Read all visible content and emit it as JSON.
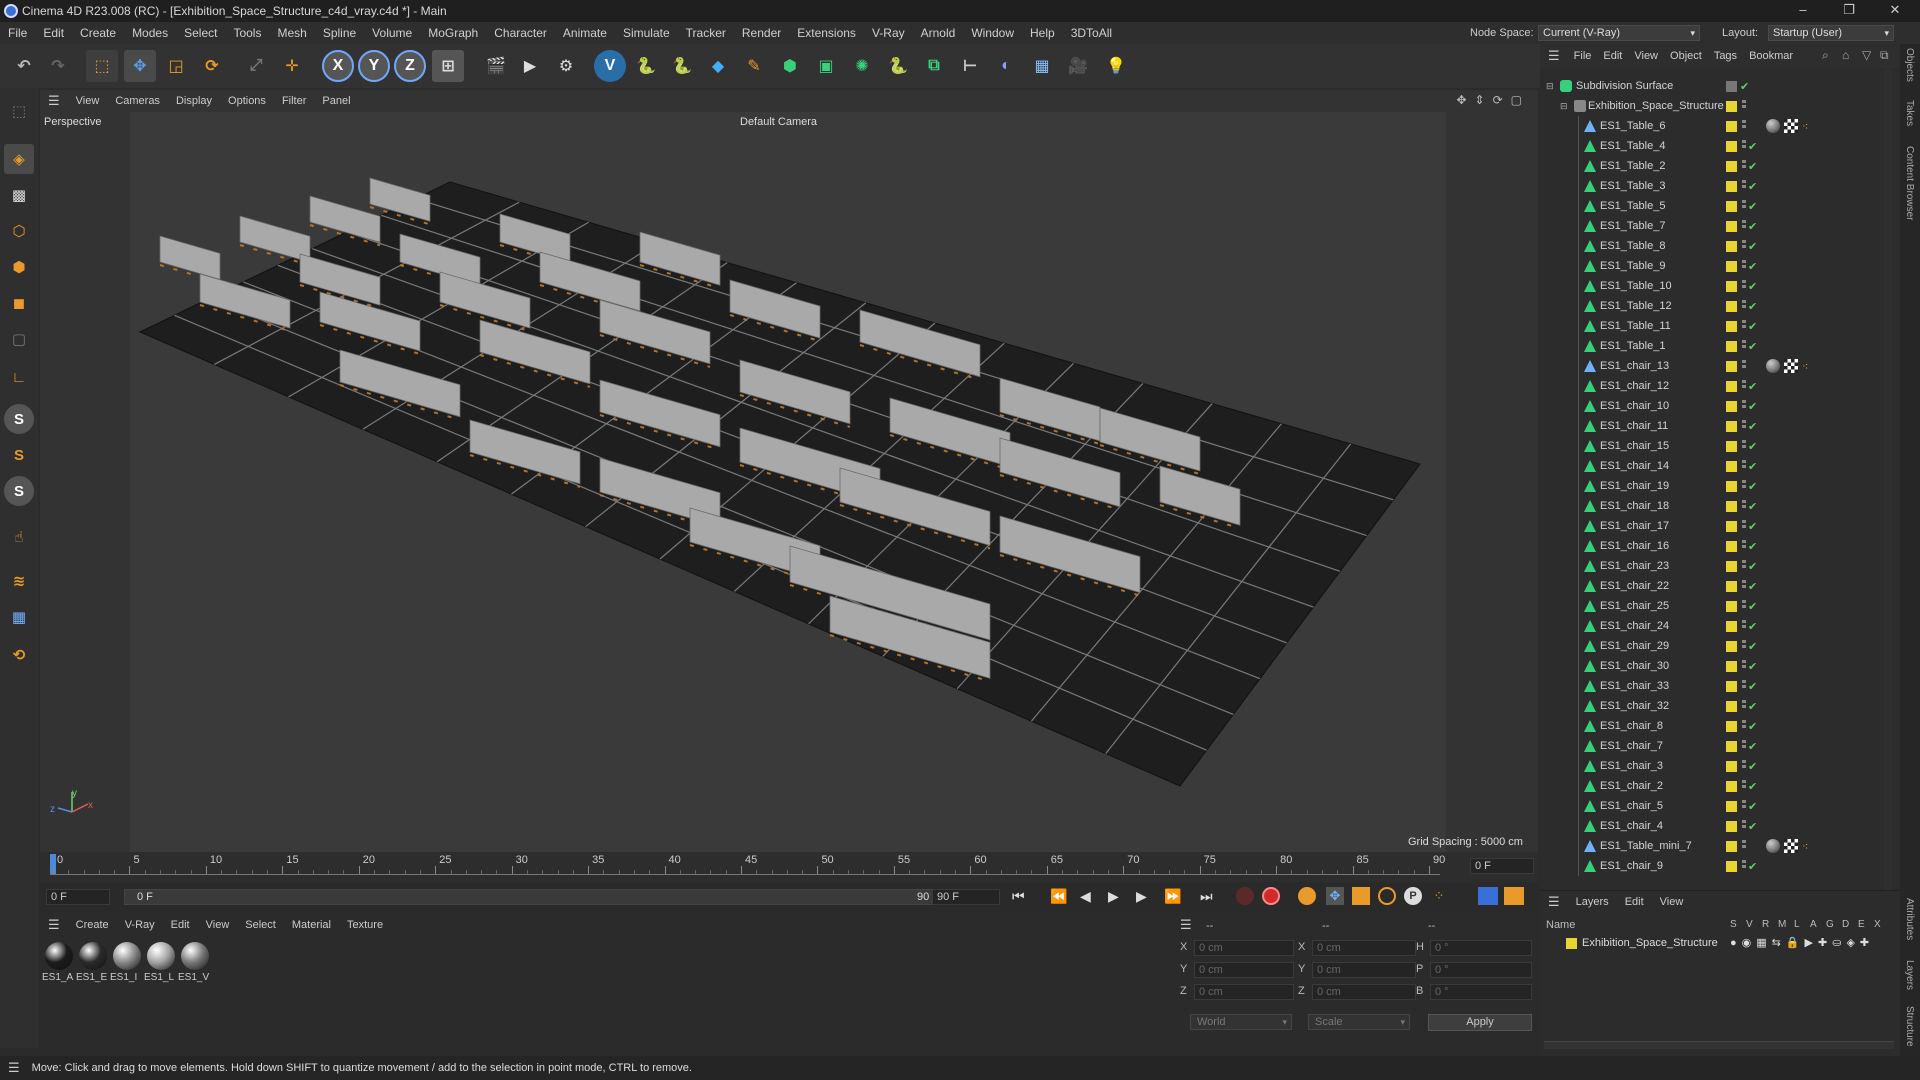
{
  "window": {
    "title": "Cinema 4D R23.008 (RC) - [Exhibition_Space_Structure_c4d_vray.c4d *] - Main",
    "minimize": "–",
    "maximize": "❐",
    "close": "✕"
  },
  "menubar": {
    "items": [
      "File",
      "Edit",
      "Create",
      "Modes",
      "Select",
      "Tools",
      "Mesh",
      "Spline",
      "Volume",
      "MoGraph",
      "Character",
      "Animate",
      "Simulate",
      "Tracker",
      "Render",
      "Extensions",
      "V-Ray",
      "Arnold",
      "Window",
      "Help",
      "3DToAll"
    ],
    "node_space_label": "Node Space:",
    "node_space_value": "Current (V-Ray)",
    "layout_label": "Layout:",
    "layout_value": "Startup (User)"
  },
  "viewport": {
    "menu": [
      "View",
      "Cameras",
      "Display",
      "Options",
      "Filter",
      "Panel"
    ],
    "label": "Perspective",
    "camera": "Default Camera",
    "grid_spacing": "Grid Spacing : 5000 cm",
    "axis_y": "y",
    "axis_x": "x",
    "axis_z": "z"
  },
  "timeline": {
    "ticks": [
      "0",
      "5",
      "10",
      "15",
      "20",
      "25",
      "30",
      "35",
      "40",
      "45",
      "50",
      "55",
      "60",
      "65",
      "70",
      "75",
      "80",
      "85",
      "90"
    ],
    "frame_right": "0 F"
  },
  "transport": {
    "start_field": "0 F",
    "range_start": "0 F",
    "range_end": "90 F",
    "end_field": "90 F"
  },
  "materials": {
    "menu": [
      "Create",
      "V-Ray",
      "Edit",
      "View",
      "Select",
      "Material",
      "Texture"
    ],
    "items": [
      {
        "label": "ES1_A",
        "tone": "#1c1c1c"
      },
      {
        "label": "ES1_E",
        "tone": "#2a2a2a"
      },
      {
        "label": "ES1_I",
        "tone": "#8a8a8a"
      },
      {
        "label": "ES1_L",
        "tone": "#a5a5a5"
      },
      {
        "label": "ES1_V",
        "tone": "#7a7a7a"
      }
    ]
  },
  "attributes": {
    "dashes": [
      "--",
      "--",
      "--"
    ],
    "rows": [
      {
        "l1": "X",
        "v1": "0 cm",
        "l2": "X",
        "v2": "0 cm",
        "l3": "H",
        "v3": "0 °"
      },
      {
        "l1": "Y",
        "v1": "0 cm",
        "l2": "Y",
        "v2": "0 cm",
        "l3": "P",
        "v3": "0 °"
      },
      {
        "l1": "Z",
        "v1": "0 cm",
        "l2": "Z",
        "v2": "0 cm",
        "l3": "B",
        "v3": "0 °"
      }
    ],
    "coord_system": "World",
    "mode": "Scale",
    "apply": "Apply"
  },
  "objects": {
    "menu": [
      "File",
      "Edit",
      "View",
      "Object",
      "Tags",
      "Bookmar"
    ],
    "root": "Subdivision Surface",
    "group": "Exhibition_Space_Structure",
    "items": [
      {
        "name": "ES1_Table_6",
        "tags": true
      },
      {
        "name": "ES1_Table_4",
        "tags": false
      },
      {
        "name": "ES1_Table_2",
        "tags": false
      },
      {
        "name": "ES1_Table_3",
        "tags": false
      },
      {
        "name": "ES1_Table_5",
        "tags": false
      },
      {
        "name": "ES1_Table_7",
        "tags": false
      },
      {
        "name": "ES1_Table_8",
        "tags": false
      },
      {
        "name": "ES1_Table_9",
        "tags": false
      },
      {
        "name": "ES1_Table_10",
        "tags": false
      },
      {
        "name": "ES1_Table_12",
        "tags": false
      },
      {
        "name": "ES1_Table_11",
        "tags": false
      },
      {
        "name": "ES1_Table_1",
        "tags": false
      },
      {
        "name": "ES1_chair_13",
        "tags": true
      },
      {
        "name": "ES1_chair_12",
        "tags": false
      },
      {
        "name": "ES1_chair_10",
        "tags": false
      },
      {
        "name": "ES1_chair_11",
        "tags": false
      },
      {
        "name": "ES1_chair_15",
        "tags": false
      },
      {
        "name": "ES1_chair_14",
        "tags": false
      },
      {
        "name": "ES1_chair_19",
        "tags": false
      },
      {
        "name": "ES1_chair_18",
        "tags": false
      },
      {
        "name": "ES1_chair_17",
        "tags": false
      },
      {
        "name": "ES1_chair_16",
        "tags": false
      },
      {
        "name": "ES1_chair_23",
        "tags": false
      },
      {
        "name": "ES1_chair_22",
        "tags": false
      },
      {
        "name": "ES1_chair_25",
        "tags": false
      },
      {
        "name": "ES1_chair_24",
        "tags": false
      },
      {
        "name": "ES1_chair_29",
        "tags": false
      },
      {
        "name": "ES1_chair_30",
        "tags": false
      },
      {
        "name": "ES1_chair_33",
        "tags": false
      },
      {
        "name": "ES1_chair_32",
        "tags": false
      },
      {
        "name": "ES1_chair_8",
        "tags": false
      },
      {
        "name": "ES1_chair_7",
        "tags": false
      },
      {
        "name": "ES1_chair_3",
        "tags": false
      },
      {
        "name": "ES1_chair_2",
        "tags": false
      },
      {
        "name": "ES1_chair_5",
        "tags": false
      },
      {
        "name": "ES1_chair_4",
        "tags": false
      },
      {
        "name": "ES1_Table_mini_7",
        "tags": true
      },
      {
        "name": "ES1_chair_9",
        "tags": false
      }
    ]
  },
  "layers": {
    "menu": [
      "Layers",
      "Edit",
      "View"
    ],
    "name_header": "Name",
    "columns": [
      "S",
      "V",
      "R",
      "M",
      "L",
      "A",
      "G",
      "D",
      "E",
      "X"
    ],
    "item": "Exhibition_Space_Structure"
  },
  "side_tabs": [
    "Objects",
    "Takes",
    "Content Browser",
    "Attributes",
    "Layers",
    "Structure"
  ],
  "status": "Move: Click and drag to move elements. Hold down SHIFT to quantize movement / add to the selection in point mode, CTRL to remove."
}
